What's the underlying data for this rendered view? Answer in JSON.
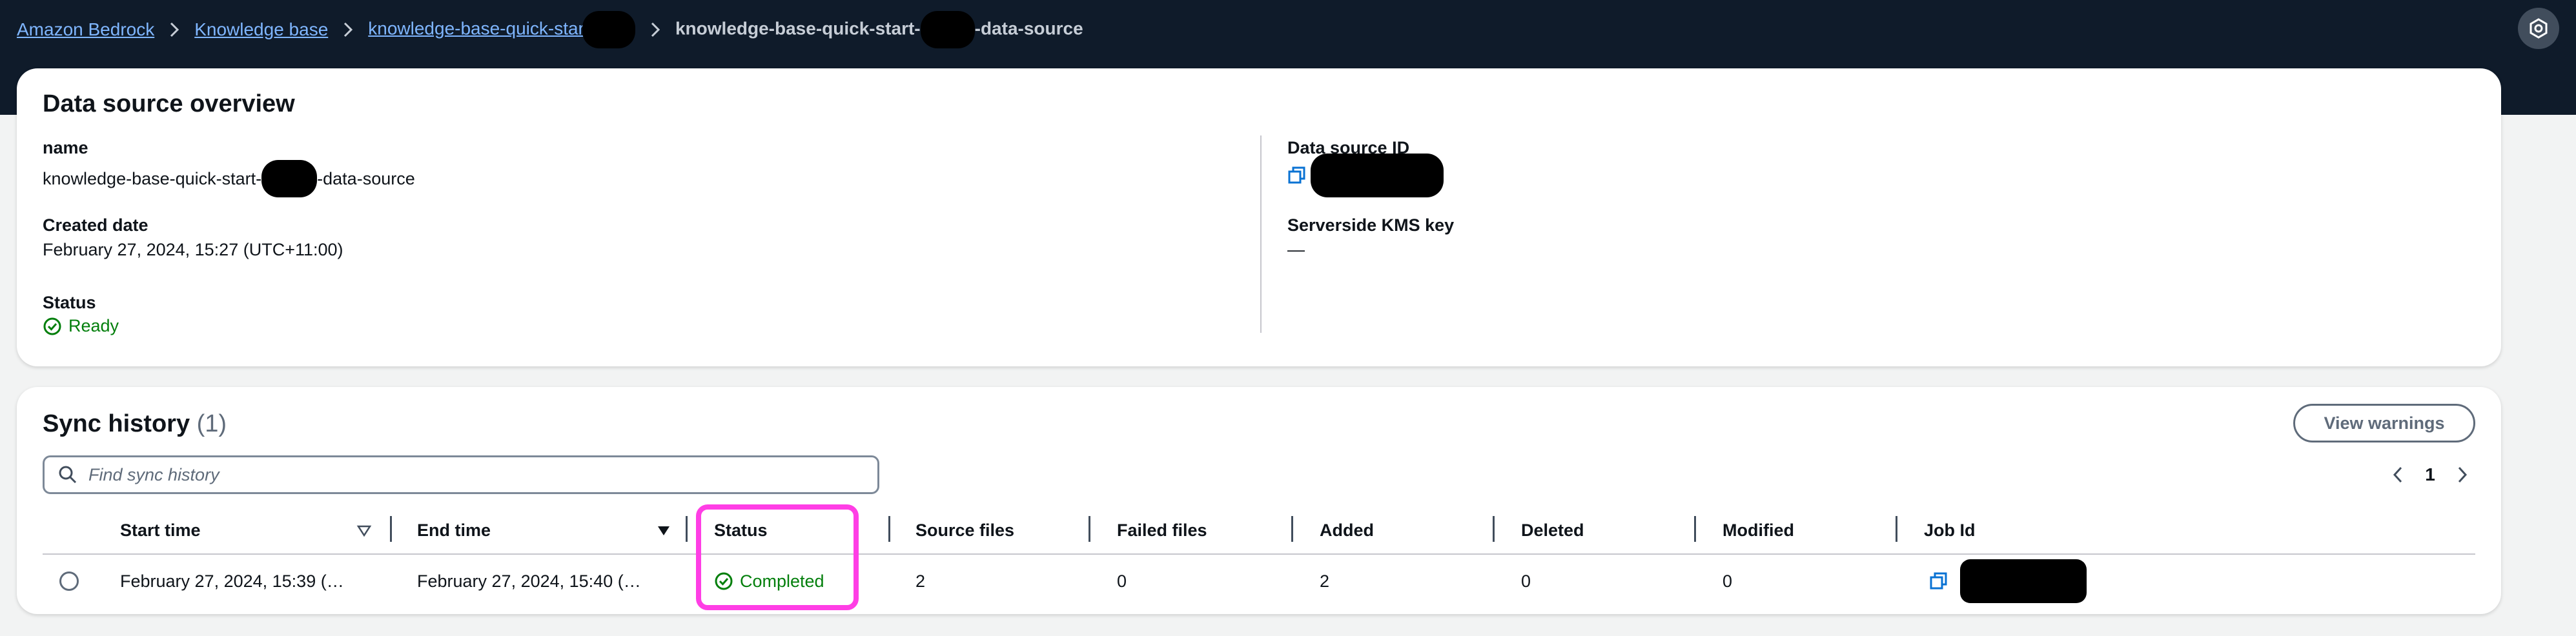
{
  "breadcrumb": {
    "items": [
      "Amazon Bedrock",
      "Knowledge base",
      "knowledge-base-quick-start-"
    ],
    "current_prefix": "knowledge-base-quick-start-",
    "current_suffix": "-data-source"
  },
  "overview": {
    "title": "Data source overview",
    "name_label": "name",
    "name_value_prefix": "knowledge-base-quick-start-",
    "name_value_suffix": "-data-source",
    "created_label": "Created date",
    "created_value": "February 27, 2024, 15:27 (UTC+11:00)",
    "status_label": "Status",
    "status_value": "Ready",
    "id_label": "Data source ID",
    "kms_label": "Serverside KMS key",
    "kms_value": "—"
  },
  "sync": {
    "title": "Sync history",
    "count": "(1)",
    "view_warnings": "View warnings",
    "search_placeholder": "Find sync history",
    "page": "1",
    "columns": [
      "Start time",
      "End time",
      "Status",
      "Source files",
      "Failed files",
      "Added",
      "Deleted",
      "Modified",
      "Job Id"
    ],
    "rows": [
      {
        "start": "February 27, 2024, 15:39 (…",
        "end": "February 27, 2024, 15:40 (…",
        "status": "Completed",
        "source_files": "2",
        "failed_files": "0",
        "added": "2",
        "deleted": "0",
        "modified": "0"
      }
    ]
  },
  "colors": {
    "topbar": "#0f1b2a",
    "link": "#7fb6ff",
    "success": "#037f0c",
    "copy_icon": "#0972d3",
    "highlight": "#ff3ee5"
  },
  "icons": [
    "chevron-right-icon",
    "settings-icon",
    "copy-icon",
    "success-check-icon",
    "search-icon",
    "sort-descending-icon",
    "sort-filled-icon",
    "chevron-left-icon"
  ]
}
